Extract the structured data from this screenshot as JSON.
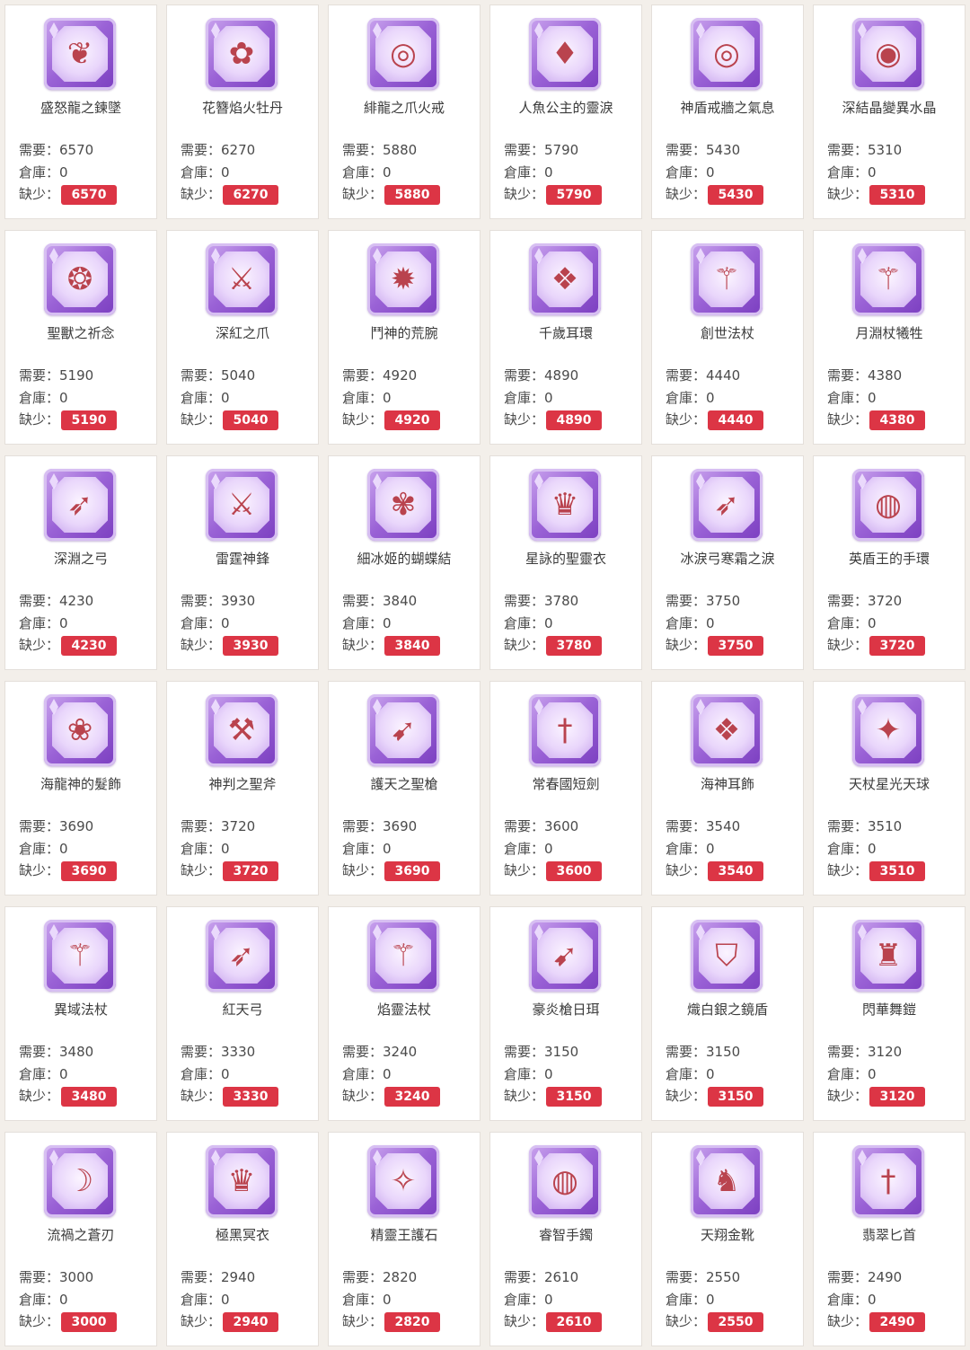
{
  "labels": {
    "need": "需要：",
    "stock": "倉庫：",
    "lack": "缺少："
  },
  "items": [
    {
      "name": "盛怒龍之鍊墜",
      "need": "6570",
      "stock": "0",
      "lack": "6570",
      "icon": "pendant-icon"
    },
    {
      "name": "花簪焰火牡丹",
      "need": "6270",
      "stock": "0",
      "lack": "6270",
      "icon": "hairpin-icon"
    },
    {
      "name": "緋龍之爪火戒",
      "need": "5880",
      "stock": "0",
      "lack": "5880",
      "icon": "ring-icon"
    },
    {
      "name": "人魚公主的靈淚",
      "need": "5790",
      "stock": "0",
      "lack": "5790",
      "icon": "teardrop-icon"
    },
    {
      "name": "神盾戒牆之氣息",
      "need": "5430",
      "stock": "0",
      "lack": "5430",
      "icon": "ring-icon"
    },
    {
      "name": "深結晶變異水晶",
      "need": "5310",
      "stock": "0",
      "lack": "5310",
      "icon": "crystal-ring-icon"
    },
    {
      "name": "聖獸之祈念",
      "need": "5190",
      "stock": "0",
      "lack": "5190",
      "icon": "amulet-icon"
    },
    {
      "name": "深紅之爪",
      "need": "5040",
      "stock": "0",
      "lack": "5040",
      "icon": "claw-icon"
    },
    {
      "name": "鬥神的荒腕",
      "need": "4920",
      "stock": "0",
      "lack": "4920",
      "icon": "gauntlet-icon"
    },
    {
      "name": "千歲耳環",
      "need": "4890",
      "stock": "0",
      "lack": "4890",
      "icon": "earring-icon"
    },
    {
      "name": "創世法杖",
      "need": "4440",
      "stock": "0",
      "lack": "4440",
      "icon": "staff-icon"
    },
    {
      "name": "月淵杖犧牲",
      "need": "4380",
      "stock": "0",
      "lack": "4380",
      "icon": "staff-icon"
    },
    {
      "name": "深淵之弓",
      "need": "4230",
      "stock": "0",
      "lack": "4230",
      "icon": "bow-icon"
    },
    {
      "name": "雷霆神鋒",
      "need": "3930",
      "stock": "0",
      "lack": "3930",
      "icon": "sword-icon"
    },
    {
      "name": "細冰姬的蝴蝶結",
      "need": "3840",
      "stock": "0",
      "lack": "3840",
      "icon": "ribbon-icon"
    },
    {
      "name": "星詠的聖靈衣",
      "need": "3780",
      "stock": "0",
      "lack": "3780",
      "icon": "robe-icon"
    },
    {
      "name": "冰淚弓寒霜之淚",
      "need": "3750",
      "stock": "0",
      "lack": "3750",
      "icon": "bow-icon"
    },
    {
      "name": "英盾王的手環",
      "need": "3720",
      "stock": "0",
      "lack": "3720",
      "icon": "bracelet-icon"
    },
    {
      "name": "海龍神的髮飾",
      "need": "3690",
      "stock": "0",
      "lack": "3690",
      "icon": "hair-ornament-icon"
    },
    {
      "name": "神判之聖斧",
      "need": "3720",
      "stock": "0",
      "lack": "3720",
      "icon": "axe-icon"
    },
    {
      "name": "護天之聖槍",
      "need": "3690",
      "stock": "0",
      "lack": "3690",
      "icon": "spear-icon"
    },
    {
      "name": "常春國短劍",
      "need": "3600",
      "stock": "0",
      "lack": "3600",
      "icon": "dagger-icon"
    },
    {
      "name": "海神耳飾",
      "need": "3540",
      "stock": "0",
      "lack": "3540",
      "icon": "earring-icon"
    },
    {
      "name": "天杖星光天球",
      "need": "3510",
      "stock": "0",
      "lack": "3510",
      "icon": "orb-staff-icon"
    },
    {
      "name": "異域法杖",
      "need": "3480",
      "stock": "0",
      "lack": "3480",
      "icon": "staff-icon"
    },
    {
      "name": "紅天弓",
      "need": "3330",
      "stock": "0",
      "lack": "3330",
      "icon": "bow-icon"
    },
    {
      "name": "焰靈法杖",
      "need": "3240",
      "stock": "0",
      "lack": "3240",
      "icon": "staff-icon"
    },
    {
      "name": "豪炎槍日珥",
      "need": "3150",
      "stock": "0",
      "lack": "3150",
      "icon": "spear-icon"
    },
    {
      "name": "熾白銀之鏡盾",
      "need": "3150",
      "stock": "0",
      "lack": "3150",
      "icon": "shield-icon"
    },
    {
      "name": "閃華舞鎧",
      "need": "3120",
      "stock": "0",
      "lack": "3120",
      "icon": "armor-icon"
    },
    {
      "name": "流禍之蒼刃",
      "need": "3000",
      "stock": "0",
      "lack": "3000",
      "icon": "blade-icon"
    },
    {
      "name": "極黑冥衣",
      "need": "2940",
      "stock": "0",
      "lack": "2940",
      "icon": "robe-icon"
    },
    {
      "name": "精靈王護石",
      "need": "2820",
      "stock": "0",
      "lack": "2820",
      "icon": "gem-icon"
    },
    {
      "name": "睿智手鐲",
      "need": "2610",
      "stock": "0",
      "lack": "2610",
      "icon": "bracelet-icon"
    },
    {
      "name": "天翔金靴",
      "need": "2550",
      "stock": "0",
      "lack": "2550",
      "icon": "boots-icon"
    },
    {
      "name": "翡翠匕首",
      "need": "2490",
      "stock": "0",
      "lack": "2490",
      "icon": "dagger-icon"
    }
  ],
  "colors": {
    "badge": "#dc3545",
    "icon_frame": "#9a62d6",
    "background": "#f3efea"
  }
}
